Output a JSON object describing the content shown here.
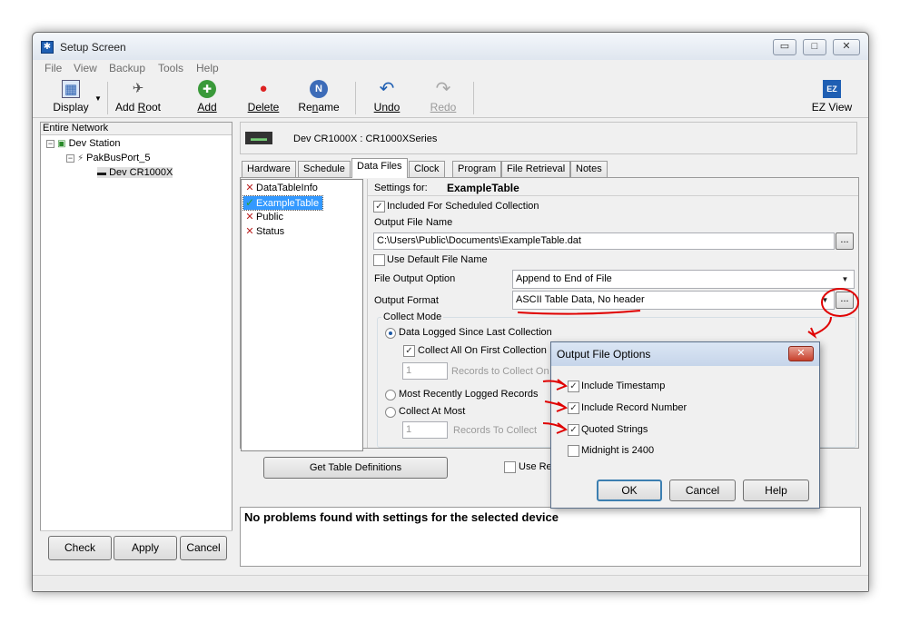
{
  "window": {
    "title": "Setup Screen",
    "controls": {
      "minimize": "▭",
      "maximize": "□",
      "close": "✕"
    }
  },
  "menu": [
    "File",
    "View",
    "Backup",
    "Tools",
    "Help"
  ],
  "toolbar": {
    "display": "Display",
    "add_root_pre": "Add ",
    "add_root_u": "R",
    "add_root_post": "oot",
    "add": "Add",
    "delete": "Delete",
    "rename_pre": "Re",
    "rename_u": "n",
    "rename_post": "ame",
    "undo": "Undo",
    "redo": "Redo",
    "ez_view": "EZ View"
  },
  "network": {
    "header": "Entire Network",
    "nodes": [
      "Dev Station",
      "PakBusPort_5",
      "Dev CR1000X"
    ]
  },
  "left_buttons": {
    "check": "Check",
    "apply": "Apply",
    "cancel": "Cancel"
  },
  "device": {
    "title": "Dev CR1000X : CR1000XSeries"
  },
  "tabs": [
    "Hardware",
    "Schedule",
    "Data Files",
    "Clock",
    "Program",
    "File Retrieval",
    "Notes"
  ],
  "tables": [
    "DataTableInfo",
    "ExampleTable",
    "Public",
    "Status"
  ],
  "settings": {
    "settings_for_label": "Settings for:",
    "table_name": "ExampleTable",
    "included_label": "Included For Scheduled Collection",
    "output_file_name_label": "Output File Name",
    "output_file_path": "C:\\Users\\Public\\Documents\\ExampleTable.dat",
    "use_default_label": "Use Default File Name",
    "file_output_option_label": "File Output Option",
    "file_output_option_value": "Append to End of File",
    "output_format_label": "Output Format",
    "output_format_value": "ASCII Table Data, No header",
    "ellipsis": "...",
    "collect_mode_label": "Collect Mode",
    "mode_since_last": "Data Logged Since Last Collection",
    "collect_all_first": "Collect All On First Collection",
    "records_value_1": "1",
    "records_label_1": "Records to Collect On",
    "mode_most_recent": "Most Recently Logged Records",
    "mode_at_most": "Collect At Most",
    "records_value_2": "1",
    "records_label_2": "Records To Collect"
  },
  "bottom": {
    "get_table_defs": "Get Table Definitions",
    "use_re": "Use Re"
  },
  "log": {
    "message": "No problems found with settings for the selected device"
  },
  "dialog": {
    "title": "Output File Options",
    "close": "✕",
    "options": [
      "Include Timestamp",
      "Include Record Number",
      "Quoted Strings",
      "Midnight is 2400"
    ],
    "ok": "OK",
    "cancel": "Cancel",
    "help": "Help"
  },
  "icons": {
    "display": "▦",
    "add_root": "✈",
    "add": "✚",
    "delete": "●",
    "rename": "N",
    "undo": "↶",
    "redo": "↷",
    "ez_view": "EZ",
    "check_green": "✓",
    "x_red": "✕",
    "check_box": "✓"
  },
  "colors": {
    "accent": "#3399ff",
    "annotation": "#e00000",
    "selection": "#3399ff"
  }
}
